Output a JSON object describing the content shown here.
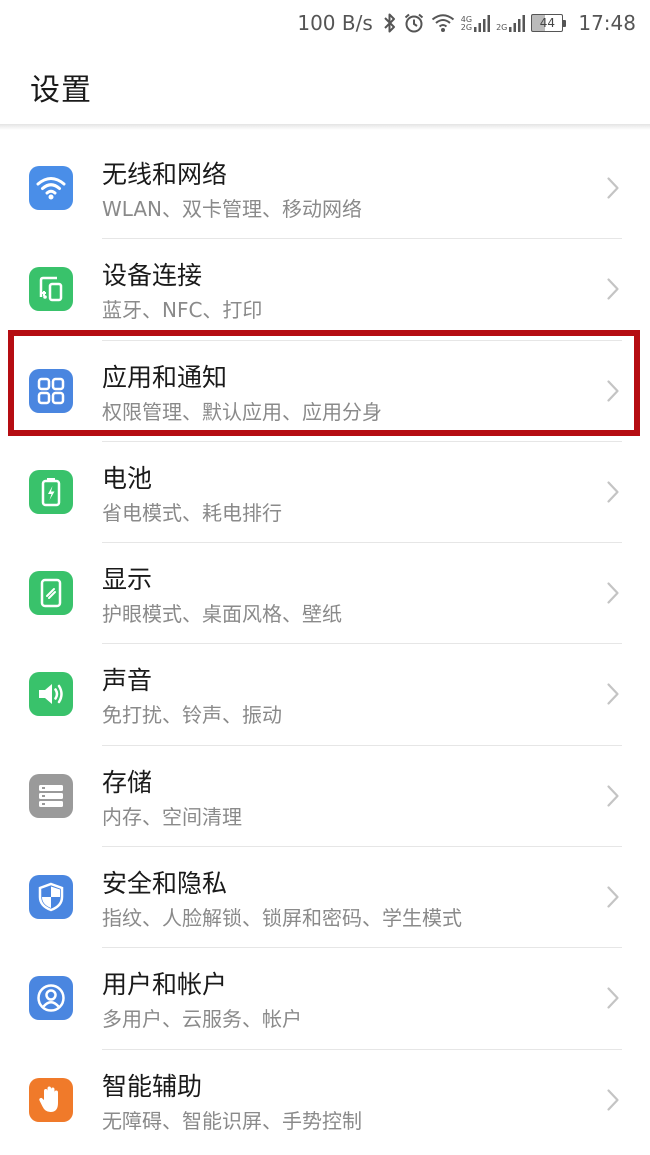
{
  "status_bar": {
    "net_speed": "100 B/s",
    "network_tags": [
      "4G",
      "2G"
    ],
    "network_tag2": "2G",
    "battery_level": "44",
    "time": "17:48",
    "icons": [
      "bluetooth-icon",
      "alarm-icon",
      "wifi-icon",
      "signal-icon",
      "signal-icon",
      "battery-icon"
    ]
  },
  "header": {
    "title": "设置"
  },
  "items": [
    {
      "title": "无线和网络",
      "subtitle": "WLAN、双卡管理、移动网络",
      "icon": "wifi-icon",
      "color": "#4a8ee8"
    },
    {
      "title": "设备连接",
      "subtitle": "蓝牙、NFC、打印",
      "icon": "device-connect-icon",
      "color": "#39c26b"
    },
    {
      "title": "应用和通知",
      "subtitle": "权限管理、默认应用、应用分身",
      "icon": "apps-grid-icon",
      "color": "#4a86e0"
    },
    {
      "title": "电池",
      "subtitle": "省电模式、耗电排行",
      "icon": "battery-icon",
      "color": "#39c26b"
    },
    {
      "title": "显示",
      "subtitle": "护眼模式、桌面风格、壁纸",
      "icon": "display-icon",
      "color": "#39c26b"
    },
    {
      "title": "声音",
      "subtitle": "免打扰、铃声、振动",
      "icon": "speaker-icon",
      "color": "#39c26b"
    },
    {
      "title": "存储",
      "subtitle": "内存、空间清理",
      "icon": "storage-icon",
      "color": "#9a9a9a"
    },
    {
      "title": "安全和隐私",
      "subtitle": "指纹、人脸解锁、锁屏和密码、学生模式",
      "icon": "shield-icon",
      "color": "#4a86e0"
    },
    {
      "title": "用户和帐户",
      "subtitle": "多用户、云服务、帐户",
      "icon": "user-icon",
      "color": "#4a86e0"
    },
    {
      "title": "智能辅助",
      "subtitle": "无障碍、智能识屏、手势控制",
      "icon": "hand-icon",
      "color": "#f07a2a"
    }
  ],
  "colors": {
    "highlight": "#b50d12",
    "chevron": "#c4c4c4"
  }
}
